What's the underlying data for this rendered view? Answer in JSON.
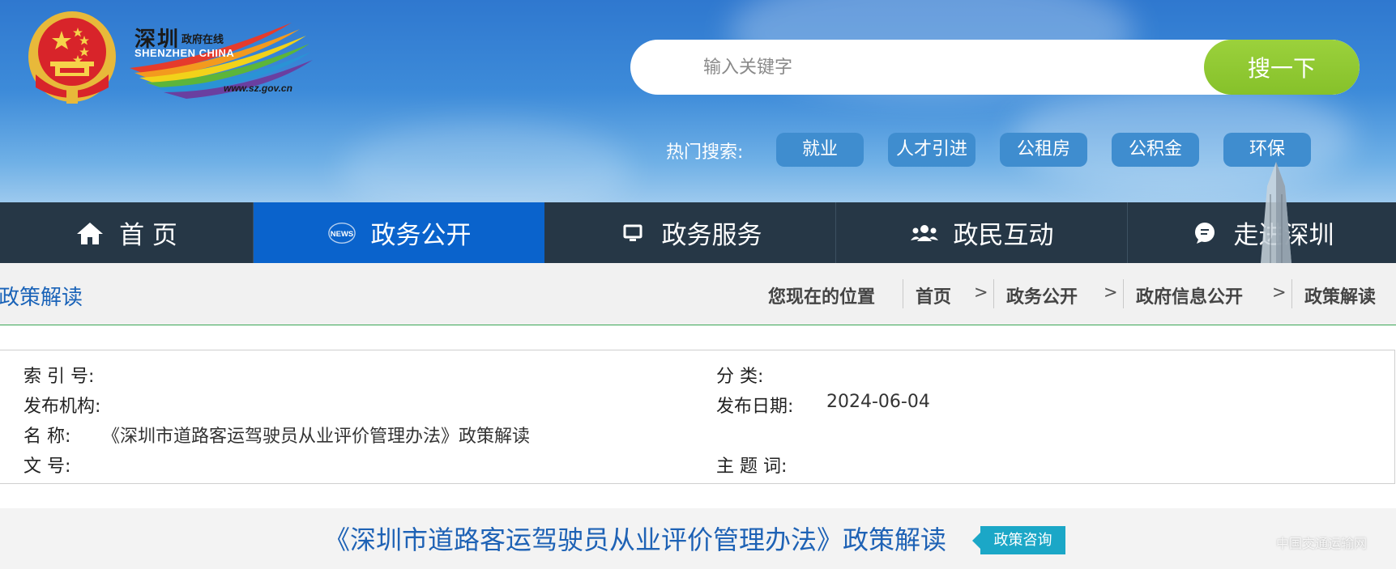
{
  "header": {
    "logo": {
      "cn_title": "深圳",
      "cn_subtitle": "政府在线",
      "en_title": "SHENZHEN CHINA",
      "url": "www.sz.gov.cn"
    },
    "search": {
      "placeholder": "输入关键字",
      "button_label": "搜一下"
    },
    "hot_search": {
      "label": "热门搜索:",
      "tags": [
        "就业",
        "人才引进",
        "公租房",
        "公积金",
        "环保"
      ]
    }
  },
  "nav": {
    "items": [
      {
        "label": "首 页",
        "icon": "home-icon",
        "active": false
      },
      {
        "label": "政务公开",
        "icon": "news-icon",
        "active": true
      },
      {
        "label": "政务服务",
        "icon": "monitor-icon",
        "active": false
      },
      {
        "label": "政民互动",
        "icon": "people-icon",
        "active": false
      },
      {
        "label": "走进深圳",
        "icon": "chat-icon",
        "active": false
      }
    ]
  },
  "breadcrumb": {
    "section_title": "政策解读",
    "location_label": "您现在的位置",
    "path": [
      "首页",
      "政务公开",
      "政府信息公开",
      "政策解读"
    ],
    "separator": ">"
  },
  "meta": {
    "index_label": "索 引 号:",
    "index_value": "",
    "category_label": "分 类:",
    "category_value": "",
    "publisher_label": "发布机构:",
    "publisher_value": "",
    "date_label": "发布日期:",
    "date_value": "2024-06-04",
    "name_label": "名 称:",
    "name_value": "《深圳市道路客运驾驶员从业评价管理办法》政策解读",
    "doc_no_label": "文 号:",
    "doc_no_value": "",
    "keywords_label": "主 题 词:",
    "keywords_value": ""
  },
  "article": {
    "title": "《深圳市道路客运驾驶员从业评价管理办法》政策解读",
    "badge": "政策咨询"
  },
  "colors": {
    "nav_bg": "#263746",
    "nav_active": "#0a63cc",
    "search_button": "#8cc72f",
    "title_blue": "#1e62b5",
    "badge": "#1ba7c7",
    "divider_green": "#3aa655"
  },
  "watermark": "中国交通运输网"
}
